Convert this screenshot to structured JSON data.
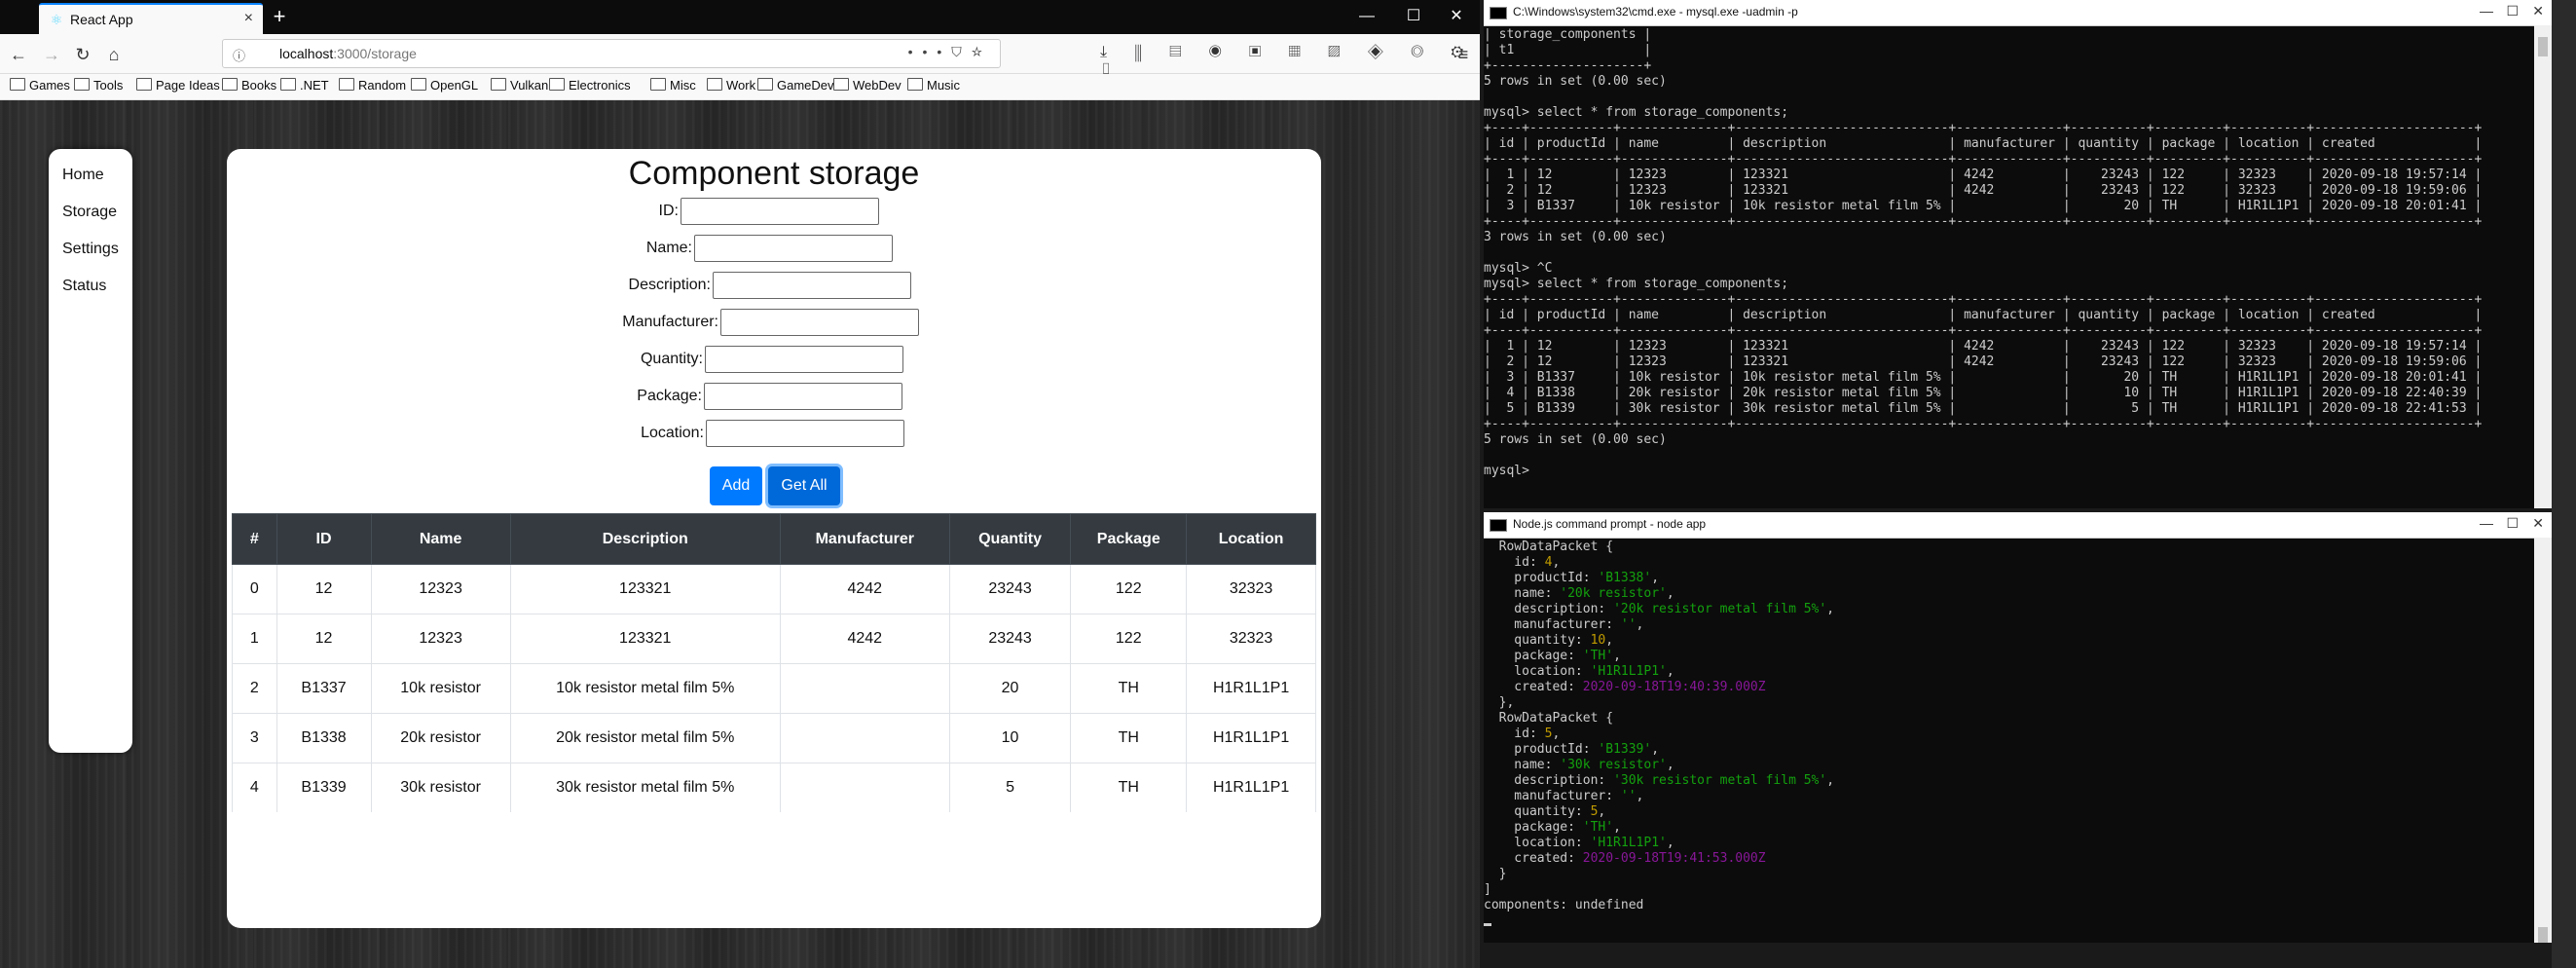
{
  "browser": {
    "tab_title": "React App",
    "url_host": "localhost",
    "url_path": ":3000/storage",
    "bookmarks": [
      "Games",
      "Tools",
      "Page Ideas",
      "Books",
      ".NET",
      "Random",
      "OpenGL",
      "Vulkan",
      "Electronics",
      "Misc",
      "Work",
      "GameDev",
      "WebDev",
      "Music"
    ]
  },
  "sidenav": {
    "items": [
      "Home",
      "Storage",
      "Settings",
      "Status"
    ]
  },
  "form": {
    "title": "Component storage",
    "fields": [
      "ID:",
      "Name:",
      "Description:",
      "Manufacturer:",
      "Quantity:",
      "Package:",
      "Location:"
    ],
    "add_label": "Add",
    "getall_label": "Get All"
  },
  "table": {
    "headers": [
      "#",
      "ID",
      "Name",
      "Description",
      "Manufacturer",
      "Quantity",
      "Package",
      "Location"
    ],
    "rows": [
      [
        "0",
        "12",
        "12323",
        "123321",
        "4242",
        "23243",
        "122",
        "32323"
      ],
      [
        "1",
        "12",
        "12323",
        "123321",
        "4242",
        "23243",
        "122",
        "32323"
      ],
      [
        "2",
        "B1337",
        "10k resistor",
        "10k resistor metal film 5%",
        "",
        "20",
        "TH",
        "H1R1L1P1"
      ],
      [
        "3",
        "B1338",
        "20k resistor",
        "20k resistor metal film 5%",
        "",
        "10",
        "TH",
        "H1R1L1P1"
      ],
      [
        "4",
        "B1339",
        "30k resistor",
        "30k resistor metal film 5%",
        "",
        "5",
        "TH",
        "H1R1L1P1"
      ]
    ]
  },
  "mysql_terminal": {
    "title": "C:\\Windows\\system32\\cmd.exe - mysql.exe -uadmin -p",
    "text": "| storage_components |\n| t1                 |\n+--------------------+\n5 rows in set (0.00 sec)\n\nmysql> select * from storage_components;\n+----+-----------+--------------+----------------------------+--------------+----------+---------+----------+---------------------+\n| id | productId | name         | description                | manufacturer | quantity | package | location | created             |\n+----+-----------+--------------+----------------------------+--------------+----------+---------+----------+---------------------+\n|  1 | 12        | 12323        | 123321                     | 4242         |    23243 | 122     | 32323    | 2020-09-18 19:57:14 |\n|  2 | 12        | 12323        | 123321                     | 4242         |    23243 | 122     | 32323    | 2020-09-18 19:59:06 |\n|  3 | B1337     | 10k resistor | 10k resistor metal film 5% |              |       20 | TH      | H1R1L1P1 | 2020-09-18 20:01:41 |\n+----+-----------+--------------+----------------------------+--------------+----------+---------+----------+---------------------+\n3 rows in set (0.00 sec)\n\nmysql> ^C\nmysql> select * from storage_components;\n+----+-----------+--------------+----------------------------+--------------+----------+---------+----------+---------------------+\n| id | productId | name         | description                | manufacturer | quantity | package | location | created             |\n+----+-----------+--------------+----------------------------+--------------+----------+---------+----------+---------------------+\n|  1 | 12        | 12323        | 123321                     | 4242         |    23243 | 122     | 32323    | 2020-09-18 19:57:14 |\n|  2 | 12        | 12323        | 123321                     | 4242         |    23243 | 122     | 32323    | 2020-09-18 19:59:06 |\n|  3 | B1337     | 10k resistor | 10k resistor metal film 5% |              |       20 | TH      | H1R1L1P1 | 2020-09-18 20:01:41 |\n|  4 | B1338     | 20k resistor | 20k resistor metal film 5% |              |       10 | TH      | H1R1L1P1 | 2020-09-18 22:40:39 |\n|  5 | B1339     | 30k resistor | 30k resistor metal film 5% |              |        5 | TH      | H1R1L1P1 | 2020-09-18 22:41:53 |\n+----+-----------+--------------+----------------------------+--------------+----------+---------+----------+---------------------+\n5 rows in set (0.00 sec)\n\nmysql>"
  },
  "node_terminal": {
    "title": "Node.js command prompt - node  app",
    "lines": [
      [
        {
          "t": "  RowDataPacket {"
        }
      ],
      [
        {
          "t": "    id: "
        },
        {
          "t": "4",
          "c": "y"
        },
        {
          "t": ","
        }
      ],
      [
        {
          "t": "    productId: "
        },
        {
          "t": "'B1338'",
          "c": "g"
        },
        {
          "t": ","
        }
      ],
      [
        {
          "t": "    name: "
        },
        {
          "t": "'20k resistor'",
          "c": "g"
        },
        {
          "t": ","
        }
      ],
      [
        {
          "t": "    description: "
        },
        {
          "t": "'20k resistor metal film 5%'",
          "c": "g"
        },
        {
          "t": ","
        }
      ],
      [
        {
          "t": "    manufacturer: "
        },
        {
          "t": "''",
          "c": "g"
        },
        {
          "t": ","
        }
      ],
      [
        {
          "t": "    quantity: "
        },
        {
          "t": "10",
          "c": "y"
        },
        {
          "t": ","
        }
      ],
      [
        {
          "t": "    package: "
        },
        {
          "t": "'TH'",
          "c": "g"
        },
        {
          "t": ","
        }
      ],
      [
        {
          "t": "    location: "
        },
        {
          "t": "'H1R1L1P1'",
          "c": "g"
        },
        {
          "t": ","
        }
      ],
      [
        {
          "t": "    created: "
        },
        {
          "t": "2020-09-18T19:40:39.000Z",
          "c": "m"
        }
      ],
      [
        {
          "t": "  },"
        }
      ],
      [
        {
          "t": "  RowDataPacket {"
        }
      ],
      [
        {
          "t": "    id: "
        },
        {
          "t": "5",
          "c": "y"
        },
        {
          "t": ","
        }
      ],
      [
        {
          "t": "    productId: "
        },
        {
          "t": "'B1339'",
          "c": "g"
        },
        {
          "t": ","
        }
      ],
      [
        {
          "t": "    name: "
        },
        {
          "t": "'30k resistor'",
          "c": "g"
        },
        {
          "t": ","
        }
      ],
      [
        {
          "t": "    description: "
        },
        {
          "t": "'30k resistor metal film 5%'",
          "c": "g"
        },
        {
          "t": ","
        }
      ],
      [
        {
          "t": "    manufacturer: "
        },
        {
          "t": "''",
          "c": "g"
        },
        {
          "t": ","
        }
      ],
      [
        {
          "t": "    quantity: "
        },
        {
          "t": "5",
          "c": "y"
        },
        {
          "t": ","
        }
      ],
      [
        {
          "t": "    package: "
        },
        {
          "t": "'TH'",
          "c": "g"
        },
        {
          "t": ","
        }
      ],
      [
        {
          "t": "    location: "
        },
        {
          "t": "'H1R1L1P1'",
          "c": "g"
        },
        {
          "t": ","
        }
      ],
      [
        {
          "t": "    created: "
        },
        {
          "t": "2020-09-18T19:41:53.000Z",
          "c": "m"
        }
      ],
      [
        {
          "t": "  }"
        }
      ],
      [
        {
          "t": "]"
        }
      ],
      [
        {
          "t": "components: undefined"
        }
      ]
    ]
  },
  "colors": {
    "accent": "#007bff",
    "table_header": "#343a40",
    "terminal_bg": "#0c0c0c"
  }
}
